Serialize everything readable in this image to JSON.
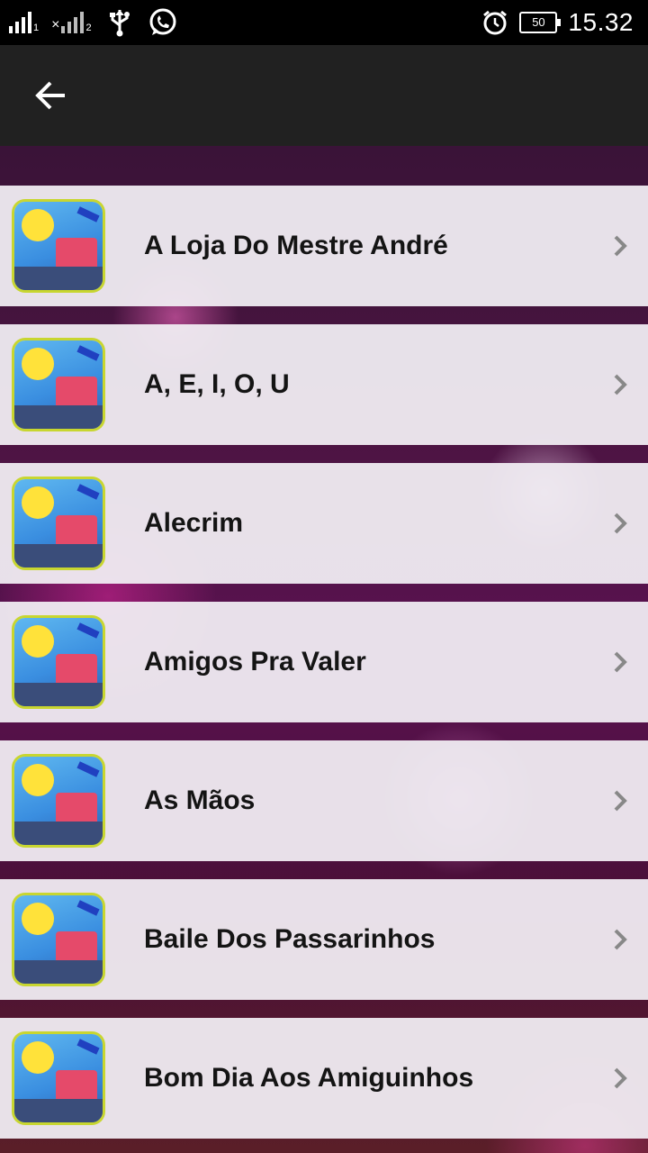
{
  "status_bar": {
    "sim1_label": "1",
    "sim2_prefix": "×",
    "sim2_label": "2",
    "battery_level": "50",
    "time": "15.32"
  },
  "app_bar": {
    "back_icon": "arrow-left-icon"
  },
  "list": {
    "items": [
      {
        "title": "A Loja Do Mestre André"
      },
      {
        "title": "A, E, I, O, U"
      },
      {
        "title": "Alecrim"
      },
      {
        "title": "Amigos Pra Valer"
      },
      {
        "title": "As Mãos"
      },
      {
        "title": "Baile Dos Passarinhos"
      },
      {
        "title": "Bom Dia Aos Amiguinhos"
      }
    ]
  }
}
